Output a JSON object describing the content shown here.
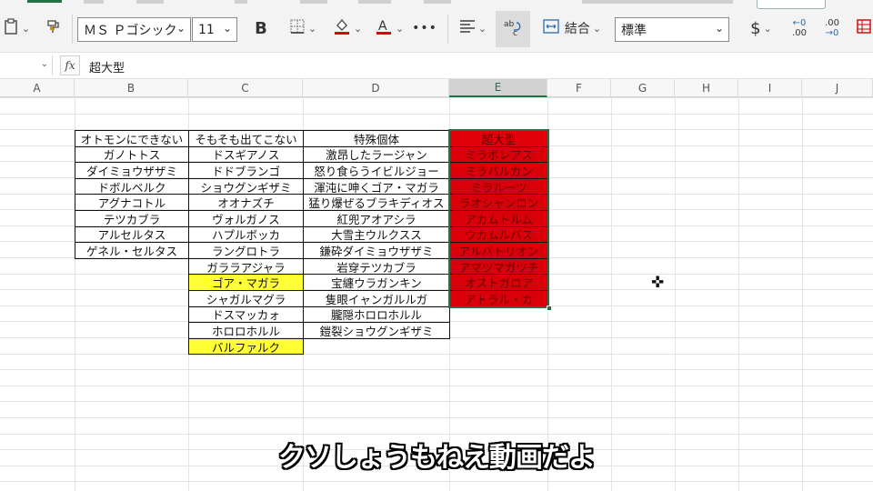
{
  "ribbon": {
    "font_name": "ＭＳ Ｐゴシック",
    "font_size": "11",
    "bold_label": "B",
    "more_label": "•••",
    "merge_label": "結合",
    "number_format": "標準",
    "currency_label": "$",
    "decimal_increase": ".00",
    "decimal_decrease": ".00"
  },
  "formula_bar": {
    "fx_label": "fx",
    "content": "超大型"
  },
  "columns": [
    "A",
    "B",
    "C",
    "D",
    "E",
    "F",
    "G",
    "H",
    "I",
    "J"
  ],
  "selected_column": "E",
  "table": {
    "b_header": "オトモンにできない",
    "b_items": [
      "ガノトトス",
      "ダイミョウザザミ",
      "ドボルベルク",
      "アグナコトル",
      "テツカブラ",
      "アルセルタス",
      "ゲネル・セルタス"
    ],
    "c_header": "そもそも出てこない",
    "c_items": [
      "ドスギアノス",
      "ドドブランゴ",
      "ショウグンギザミ",
      "オオナズチ",
      "ヴォルガノス",
      "ハプルボッカ",
      "ラングロトラ",
      "ガララアジャラ",
      "ゴア・マガラ",
      "シャガルマグラ",
      "ドスマッカォ",
      "ホロロホルル",
      "バルファルク"
    ],
    "c_highlight_indices": [
      8,
      12
    ],
    "d_header": "特殊個体",
    "d_items": [
      "激昂したラージャン",
      "怒り食らうイビルジョー",
      "渾沌に呻くゴア・マガラ",
      "猛り爆ぜるブラキディオス",
      "紅兜アオアシラ",
      "大雪主ウルクスス",
      "鎌砕ダイミョウザザミ",
      "岩穿テツカブラ",
      "宝纏ウラガンキン",
      "隻眼イャンガルルガ",
      "朧隠ホロロホルル",
      "鎧裂ショウグンギザミ"
    ],
    "e_header": "超大型",
    "e_items": [
      "ミラボレアス",
      "ミラバルカン",
      "ミラルーツ",
      "ラオシャンロン",
      "アカムトルム",
      "ウカムルバス",
      "アルバトリオン",
      "アマツマガツチ",
      "オストガロア",
      "アトラル・カ"
    ],
    "colors": {
      "highlight_yellow": "#ffff33",
      "red_fill": "#d9000a",
      "selection_green": "#217346"
    }
  },
  "subtitle": "クソしょうもねえ動画だよ",
  "icons": [
    "clipboard-icon",
    "format-painter-icon",
    "borders-icon",
    "fill-color-icon",
    "font-color-icon",
    "align-icon",
    "wrap-text-icon",
    "merge-icon",
    "currency-icon",
    "increase-decimal-icon",
    "decrease-decimal-icon",
    "grid-icon",
    "cursor-cross-icon"
  ]
}
